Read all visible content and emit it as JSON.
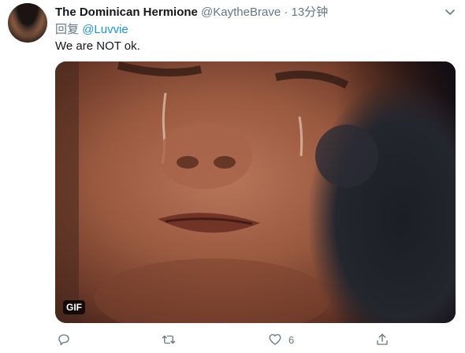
{
  "tweet": {
    "author_name": "The Dominican Hermione",
    "handle": "@KaytheBrave",
    "separator": "·",
    "time": "13分钟",
    "reply_prefix": "回复",
    "reply_mention": "@Luvvie",
    "text": "We are NOT ok.",
    "media_badge": "GIF",
    "actions": {
      "reply_count": "",
      "retweet_count": "",
      "like_count": "6",
      "share_count": ""
    }
  },
  "icons": {
    "caret": "chevron-down-icon",
    "reply": "reply-icon",
    "retweet": "retweet-icon",
    "like": "heart-icon",
    "share": "share-icon"
  },
  "colors": {
    "text": "#14171a",
    "secondary": "#657786",
    "link": "#1b95e0"
  }
}
